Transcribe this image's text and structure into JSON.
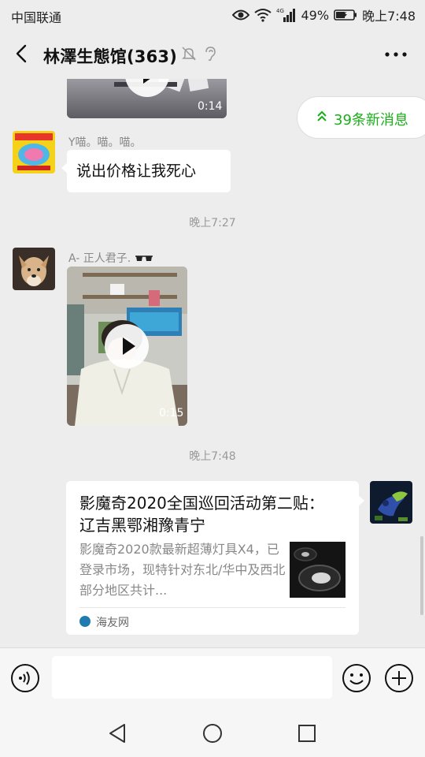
{
  "status_bar": {
    "carrier": "中国联通",
    "network": "4G",
    "battery": "49%",
    "time": "晚上7:48"
  },
  "header": {
    "title": "林澤生態馆(363)",
    "icons": [
      "back-icon",
      "mute-bell-icon",
      "ear-icon",
      "more-icon"
    ]
  },
  "new_messages": {
    "label": "39条新消息"
  },
  "messages": [
    {
      "type": "video",
      "duration": "0:14"
    },
    {
      "type": "text",
      "sender": "Y喵。喵。喵。",
      "text": "说出价格让我死心"
    },
    {
      "type": "time",
      "text": "晚上7:27"
    },
    {
      "type": "video",
      "sender": "A-  正人君子.",
      "duration": "0:15"
    },
    {
      "type": "time",
      "text": "晚上7:48"
    },
    {
      "type": "link_card",
      "title": "影魔奇2020全国巡回活动第二贴： 辽吉黑鄂湘豫青宁",
      "description": "影魔奇2020款最新超薄灯具X4，已登录市场，现特针对东北/华中及西北部分地区共计...",
      "source": "海友网"
    }
  ],
  "input_bar": {
    "icons": [
      "voice-icon",
      "emoji-icon",
      "plus-icon"
    ],
    "text": ""
  },
  "nav_bar": {
    "icons": [
      "nav-back-icon",
      "nav-home-icon",
      "nav-recents-icon"
    ]
  },
  "colors": {
    "accent_green": "#1aad19",
    "background": "#ededed"
  }
}
